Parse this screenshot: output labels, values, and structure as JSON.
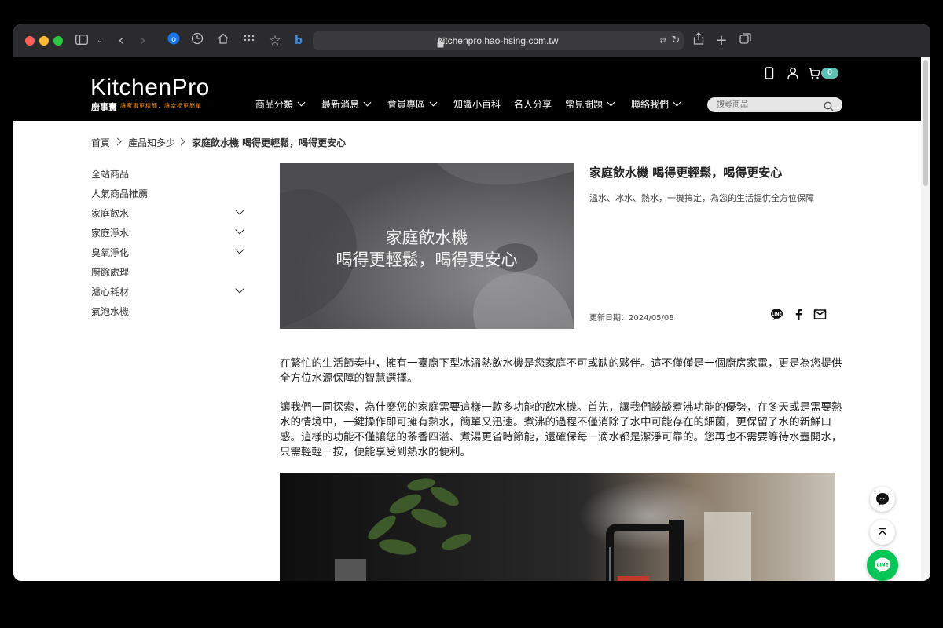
{
  "browser": {
    "url": "kitchenpro.hao-hsing.com.tw"
  },
  "header": {
    "logo_text": "KitchenPro",
    "logo_sub": "廚事寶",
    "logo_tagline": "讓廚事更精簡．讓幸福更簡單",
    "nav": [
      {
        "label": "商品分類",
        "dropdown": true
      },
      {
        "label": "最新消息",
        "dropdown": true
      },
      {
        "label": "會員專區",
        "dropdown": true
      },
      {
        "label": "知識小百科",
        "dropdown": false
      },
      {
        "label": "名人分享",
        "dropdown": false
      },
      {
        "label": "常見問題",
        "dropdown": true
      },
      {
        "label": "聯絡我們",
        "dropdown": true
      }
    ],
    "search_placeholder": "搜尋商品",
    "cart_count": "0"
  },
  "breadcrumb": [
    "首頁",
    "產品知多少",
    "家庭飲水機 喝得更輕鬆，喝得更安心"
  ],
  "sidebar": [
    {
      "label": "全站商品",
      "expandable": false
    },
    {
      "label": "人氣商品推薦",
      "expandable": false
    },
    {
      "label": "家庭飲水",
      "expandable": true
    },
    {
      "label": "家庭淨水",
      "expandable": true
    },
    {
      "label": "臭氧淨化",
      "expandable": true
    },
    {
      "label": "廚餘處理",
      "expandable": false
    },
    {
      "label": "濾心耗材",
      "expandable": true
    },
    {
      "label": "氣泡水機",
      "expandable": false
    }
  ],
  "article": {
    "hero_line1": "家庭飲水機",
    "hero_line2": "喝得更輕鬆，喝得更安心",
    "title": "家庭飲水機 喝得更輕鬆，喝得更安心",
    "subtitle": "溫水、冰水、熱水，一機搞定，為您的生活提供全方位保障",
    "date": "更新日期：2024/05/08",
    "paragraphs": [
      "在繁忙的生活節奏中，擁有一臺廚下型冰溫熱飲水機是您家庭不可或缺的夥伴。這不僅僅是一個廚房家電，更是為您提供全方位水源保障的智慧選擇。",
      "讓我們一同探索，為什麼您的家庭需要這樣一款多功能的飲水機。首先，讓我們談談煮沸功能的優勢，在冬天或是需要熱水的情境中，一鍵操作即可擁有熱水，簡單又迅速。煮沸的過程不僅消除了水中可能存在的細菌，更保留了水的新鮮口感。這樣的功能不僅讓您的茶香四溢、煮湯更省時節能，還確保每一滴水都是潔淨可靠的。您再也不需要等待水壺開水，只需輕輕一按，便能享受到熱水的便利。"
    ]
  },
  "colors": {
    "header_bg": "#000000",
    "badge": "#5fc1b6",
    "line_green": "#06c755",
    "logo_accent": "#e08a1e"
  }
}
